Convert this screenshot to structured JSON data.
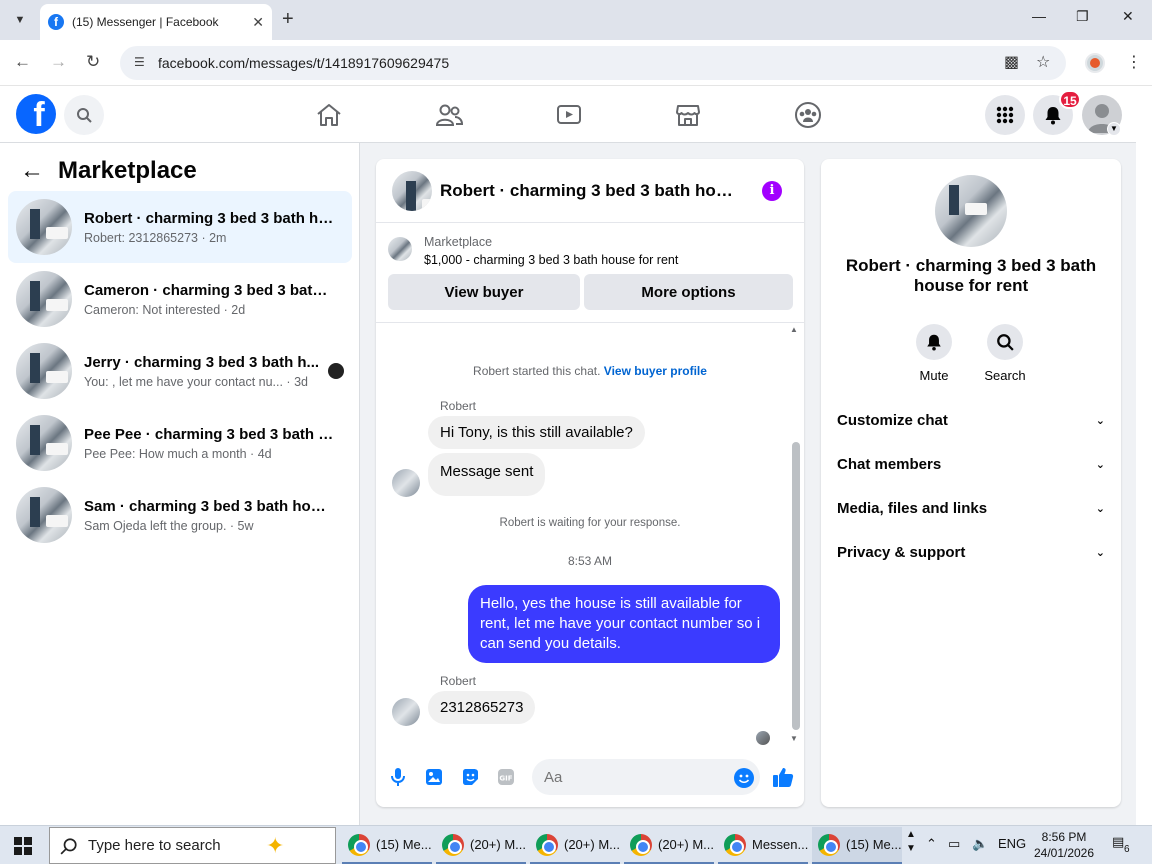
{
  "browser": {
    "tab_title": "(15) Messenger | Facebook",
    "url": "facebook.com/messages/t/1418917609629475"
  },
  "topbar": {
    "notification_count": "15"
  },
  "sidebar": {
    "title": "Marketplace",
    "conversations": [
      {
        "name": "Robert · charming 3 bed 3 bath ho...",
        "preview": "Robert: 2312865273 · 2m",
        "active": true
      },
      {
        "name": "Cameron · charming 3 bed 3 bath ...",
        "preview": "Cameron: Not interested · 2d"
      },
      {
        "name": "Jerry · charming 3 bed 3 bath h...",
        "preview": "You: , let me have your contact nu...   · 3d"
      },
      {
        "name": "Pee Pee · charming 3 bed 3 bath h...",
        "preview": "Pee Pee: How much a month · 4d"
      },
      {
        "name": "Sam · charming 3 bed 3 bath hous...",
        "preview": "Sam Ojeda left the group. · 5w"
      }
    ]
  },
  "chat": {
    "title": "Robert · charming 3 bed 3 bath hous...",
    "marketplace_label": "Marketplace",
    "listing": "$1,000 - charming 3 bed 3 bath house for rent",
    "view_buyer_label": "View buyer",
    "more_options_label": "More options",
    "started_text": "Robert started this chat.",
    "view_profile_link": "View buyer profile",
    "sender_name": "Robert",
    "msg1": "Hi Tony, is this still available?",
    "msg2": "Message sent",
    "waiting_text": "Robert is waiting for your response.",
    "timestamp": "8:53 AM",
    "reply": "Hello, yes the house is still available for rent, let me have your contact number so i can send you details.",
    "msg3": "2312865273",
    "composer_placeholder": "Aa"
  },
  "details": {
    "title": "Robert · charming 3 bed 3 bath house for rent",
    "mute_label": "Mute",
    "search_label": "Search",
    "rows": [
      "Customize chat",
      "Chat members",
      "Media, files and links",
      "Privacy & support"
    ]
  },
  "taskbar": {
    "search_placeholder": "Type here to search",
    "apps": [
      "(15) Me...",
      "(20+) M...",
      "(20+) M...",
      "(20+) M...",
      "Messen...",
      "(15) Me..."
    ],
    "language": "ENG",
    "time": "8:56 PM",
    "date": "24/01/2026",
    "notif_count": "6"
  },
  "colors": {
    "fb_blue": "#0866ff",
    "outgoing_bubble": "#3b3bff",
    "badge_red": "#e41e3f",
    "info_purple": "#a200ff"
  }
}
